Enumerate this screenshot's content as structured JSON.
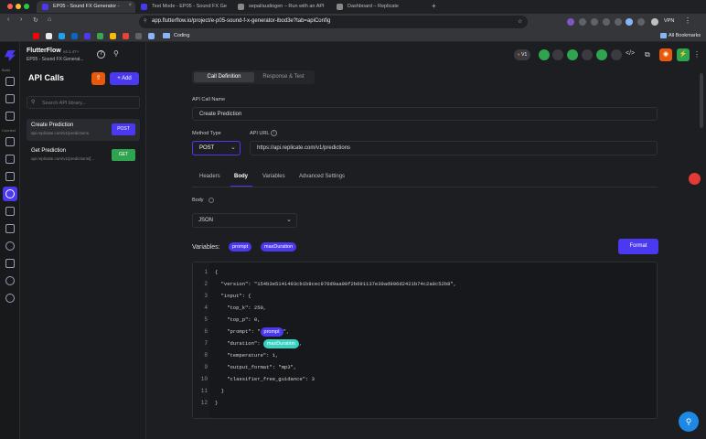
{
  "browser": {
    "tabs": [
      {
        "label": "EP05 - Sound FX Generator -",
        "active": true
      },
      {
        "label": "Test Mode - EP05 - Sound FX Ge",
        "active": false
      },
      {
        "label": "sepal/audiogen – Run with an API",
        "active": false
      },
      {
        "label": "Dashboard – Replicate",
        "active": false
      }
    ],
    "url": "app.flutterflow.io/project/e-p05-sound-f-x-generator-ibod3e?tab=apiConfig",
    "vpn": "VPN",
    "bookmarks_folder": "Coding",
    "all_bookmarks": "All Bookmarks"
  },
  "app": {
    "brand": "FlutterFlow",
    "version": "v4.1.47+",
    "project": "EP05 - Sound FX Generat...",
    "rail_labels": {
      "build": "Build",
      "connect": "Connect"
    }
  },
  "panel": {
    "title": "API Calls",
    "add_label": "Add",
    "search_placeholder": "Search API library...",
    "items": [
      {
        "name": "Create Prediction",
        "url": "api.replicate.com/v1/predictions",
        "method": "POST",
        "selected": true
      },
      {
        "name": "Get Prediction",
        "url": "api.replicate.com/v1/predictions/[...",
        "method": "GET",
        "selected": false
      }
    ]
  },
  "topbar": {
    "version_badge": "V1"
  },
  "main": {
    "tabs": [
      "Call Definition",
      "Response & Test"
    ],
    "api_call_name_label": "API Call Name",
    "api_call_name": "Create Prediction",
    "method_type_label": "Method Type",
    "method": "POST",
    "api_url_label": "API URL",
    "api_url": "https://api.replicate.com/v1/predictions",
    "subtabs": [
      "Headers",
      "Body",
      "Variables",
      "Advanced Settings"
    ],
    "active_subtab": "Body",
    "body_label": "Body",
    "body_type": "JSON",
    "variables_label": "Variables:",
    "variables": [
      "prompt",
      "maxDuration"
    ],
    "format_label": "Format",
    "code_lines": [
      "{",
      "  \"version\": \"154b3e5141493cb1b8cec976d9aa90f2b691137e39ad906d2421b74c2a8c52b8\",",
      "  \"input\": {",
      "    \"top_k\": 250,",
      "    \"top_p\": 0,",
      "    \"prompt\": \"",
      "    \"duration\": ",
      "    \"temperature\": 1,",
      "    \"output_format\": \"mp3\",",
      "    \"classifier_free_guidance\": 3",
      "  }",
      "}"
    ],
    "code_tail_prompt": "\",",
    "code_tail_duration": ",",
    "line_numbers": [
      "1",
      "2",
      "3",
      "4",
      "5",
      "6",
      "7",
      "8",
      "9",
      "10",
      "11",
      "12"
    ]
  },
  "colors": {
    "accent": "#4b39ef",
    "teal": "#39d2c0",
    "get_green": "#2ea44f"
  }
}
